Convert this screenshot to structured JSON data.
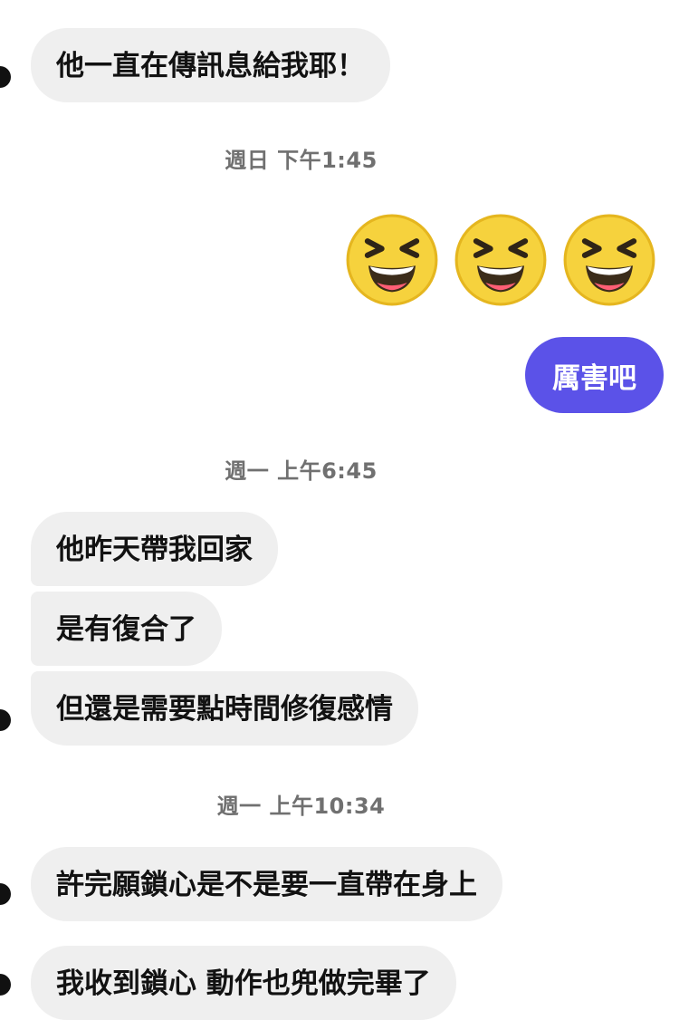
{
  "chat": {
    "messages": [
      {
        "text": "他一直在傳訊息給我耶！"
      },
      {
        "text": "他昨天帶我回家"
      },
      {
        "text": "是有復合了"
      },
      {
        "text": "但還是需要點時間修復感情"
      },
      {
        "text": "許完願鎖心是不是要一直帶在身上"
      },
      {
        "text": "我收到鎖心 動作也兜做完畢了"
      }
    ],
    "timestamps": [
      "週日 下午1:45",
      "週一 上午6:45",
      "週一 上午10:34"
    ],
    "outgoing": {
      "text": "厲害吧"
    },
    "emoji": {
      "name": "grinning-squinting-face",
      "count": 3
    }
  },
  "colors": {
    "incoming_bubble": "#efefef",
    "outgoing_bubble": "#5b52e8",
    "timestamp": "#707070"
  }
}
